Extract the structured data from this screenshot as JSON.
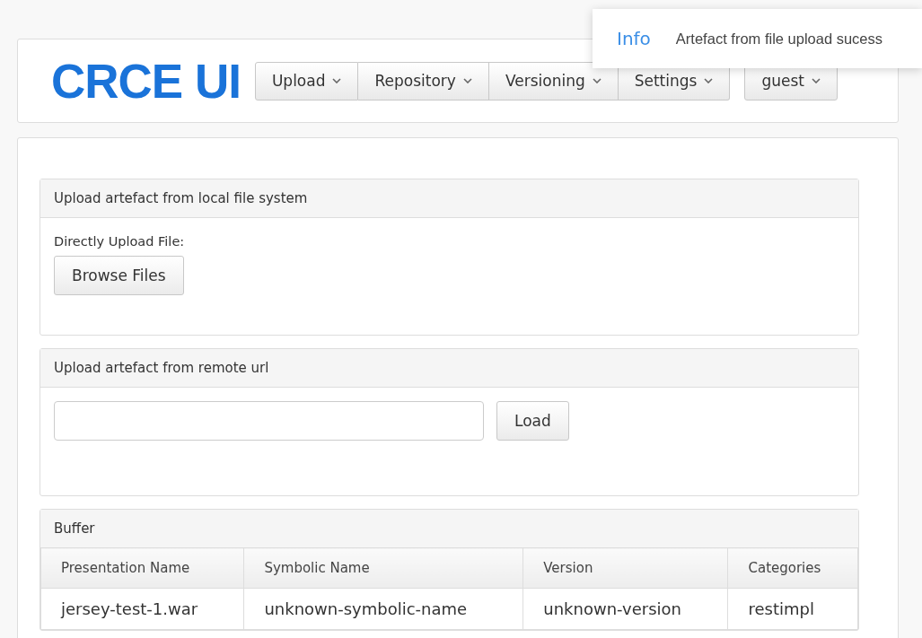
{
  "logo": "CRCE UI",
  "nav": [
    {
      "label": "Upload"
    },
    {
      "label": "Repository"
    },
    {
      "label": "Versioning"
    },
    {
      "label": "Settings"
    }
  ],
  "user_menu": {
    "label": "guest"
  },
  "toast": {
    "title": "Info",
    "message": "Artefact from file upload sucess"
  },
  "local_panel": {
    "title": "Upload artefact from local file system",
    "label": "Directly Upload File:",
    "button": "Browse Files"
  },
  "remote_panel": {
    "title": "Upload artefact from remote url",
    "button": "Load"
  },
  "buffer": {
    "title": "Buffer",
    "columns": [
      "Presentation Name",
      "Symbolic Name",
      "Version",
      "Categories"
    ],
    "rows": [
      [
        "jersey-test-1.war",
        "unknown-symbolic-name",
        "unknown-version",
        "restimpl"
      ]
    ]
  }
}
